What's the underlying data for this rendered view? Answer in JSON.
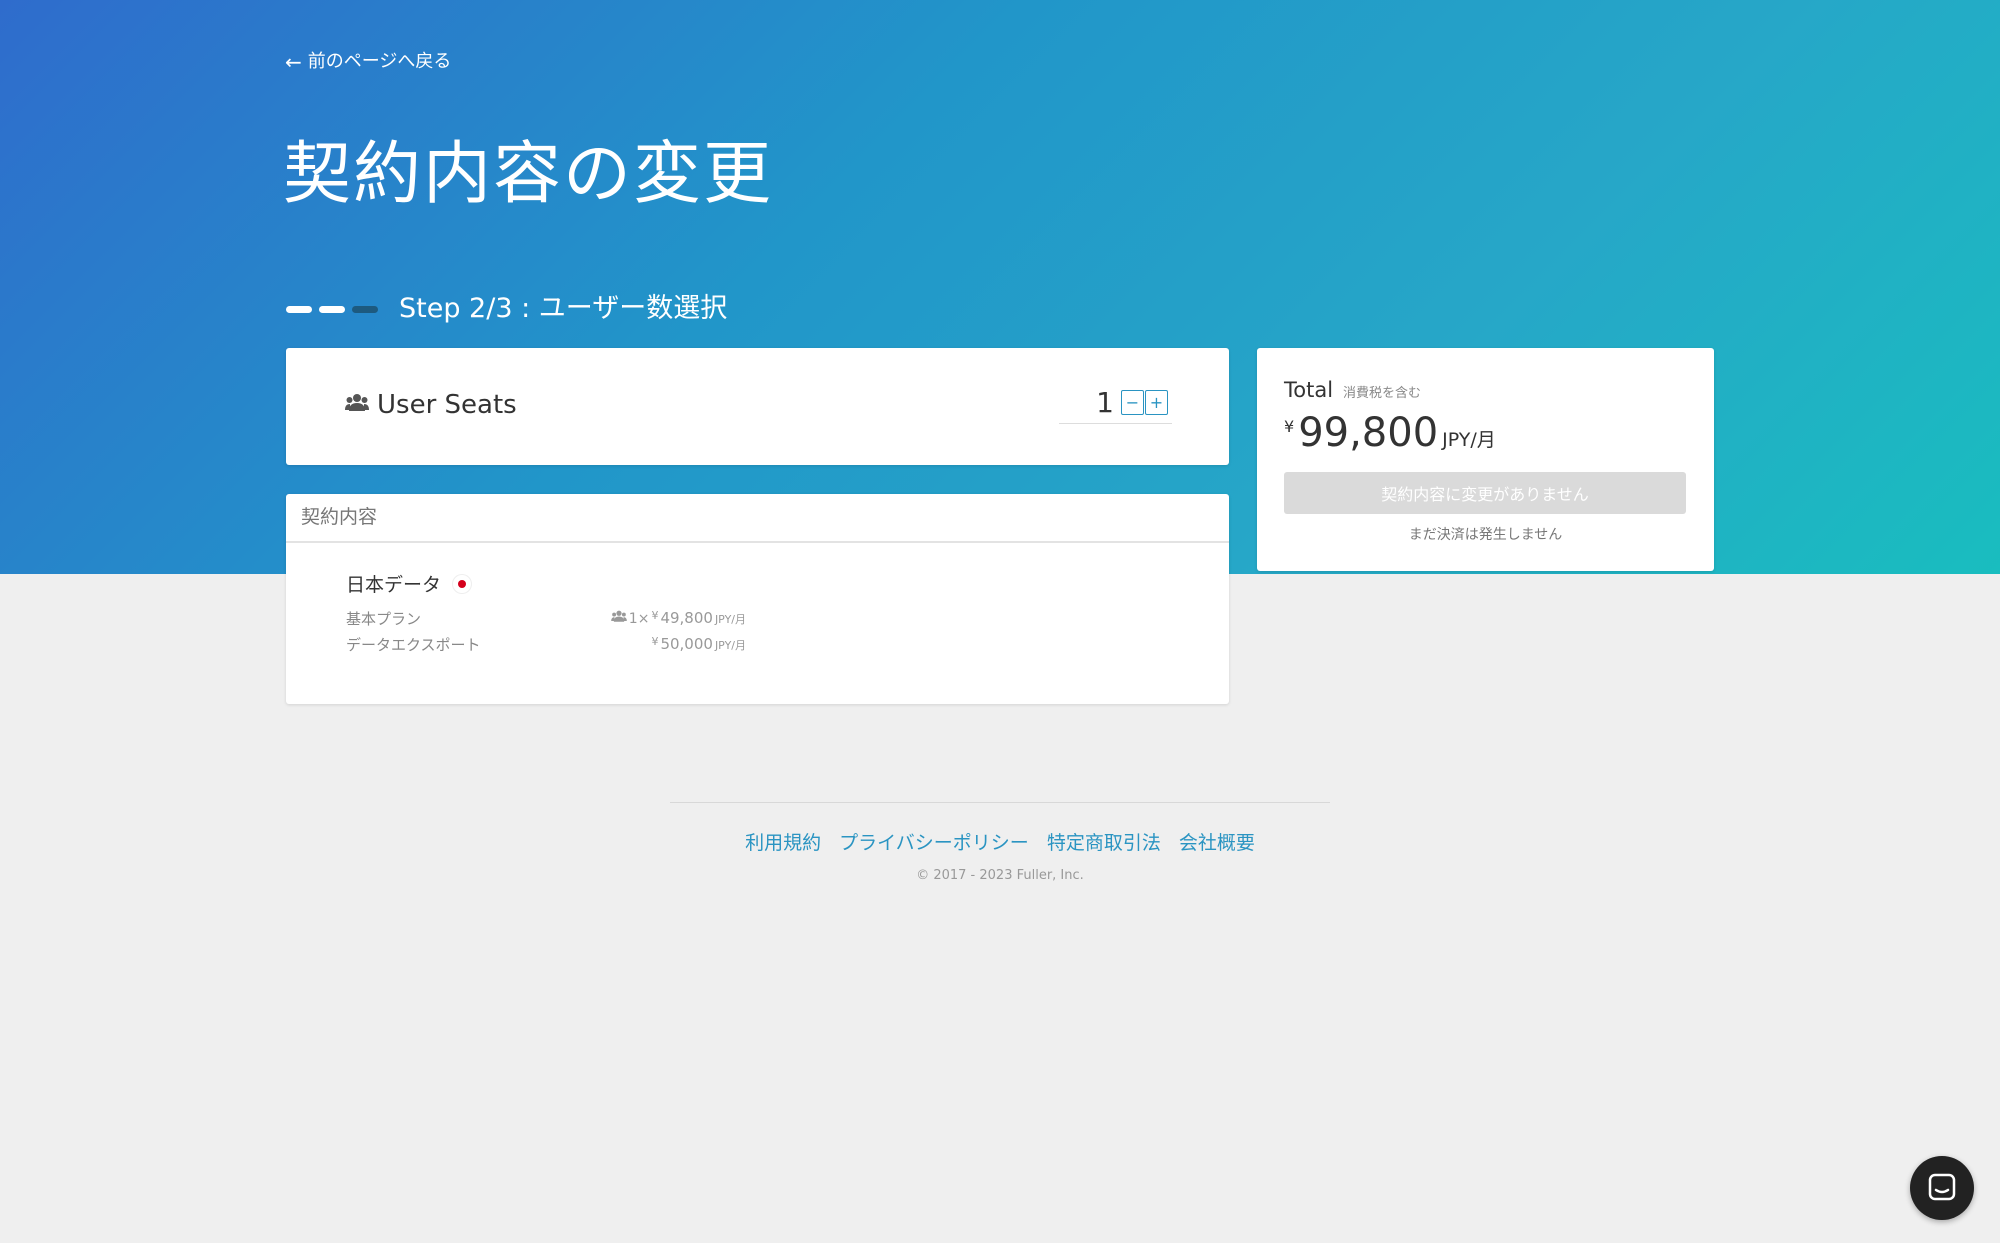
{
  "header": {
    "back_link": "前のページへ戻る",
    "title": "契約内容の変更",
    "step_label": "Step 2/3 : ユーザー数選択",
    "steps_total": 3,
    "steps_completed": 2
  },
  "seats": {
    "label": "User Seats",
    "value": "1",
    "minus_label": "−",
    "plus_label": "+"
  },
  "contract": {
    "header": "契約内容",
    "name": "日本データ",
    "items": [
      {
        "label": "基本プラン",
        "count": "1×",
        "yen": "¥",
        "price": "49,800",
        "unit": "JPY/月"
      },
      {
        "label": "データエクスポート",
        "count": "",
        "yen": "¥",
        "price": "50,000",
        "unit": "JPY/月"
      }
    ]
  },
  "total": {
    "label": "Total",
    "tax_note": "消費税を含む",
    "yen": "¥",
    "amount": "99,800",
    "unit": "JPY/月",
    "button_label": "契約内容に変更がありません",
    "no_payment_note": "まだ決済は発生しません"
  },
  "footer": {
    "links": [
      "利用規約",
      "プライバシーポリシー",
      "特定商取引法",
      "会社概要"
    ],
    "copyright": "© 2017 - 2023 Fuller, Inc."
  },
  "colors": {
    "accent": "#2a94c2",
    "hero_start": "#2f6ccc",
    "hero_end": "#19bdbf",
    "flag_red": "#d4001c"
  }
}
